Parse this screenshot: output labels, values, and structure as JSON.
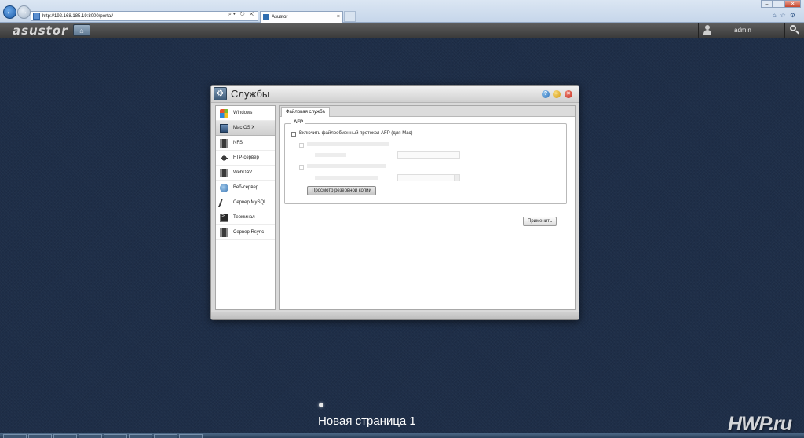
{
  "browser": {
    "address": "http://192.168.185.19:8000/portal/",
    "tab_title": "Asustor",
    "tab_close": "×",
    "window_controls": {
      "minimize": "–",
      "maximize": "□",
      "close": "✕"
    },
    "toolbar_icons": "⌂☆⚙",
    "address_tools": "⌕▾ ↻ ✕"
  },
  "asustor_bar": {
    "logo": "asustor",
    "username": "admin"
  },
  "window": {
    "title": "Службы",
    "help": "?",
    "minimize": "–",
    "close": "×",
    "sidebar": [
      {
        "label": "Windows",
        "icon": "windows-icon"
      },
      {
        "label": "Mac OS X",
        "icon": "mac-icon",
        "active": true
      },
      {
        "label": "NFS",
        "icon": "server-icon"
      },
      {
        "label": "FTP-сервер",
        "icon": "ftp-icon"
      },
      {
        "label": "WebDAV",
        "icon": "server-icon"
      },
      {
        "label": "Веб-сервер",
        "icon": "web-icon"
      },
      {
        "label": "Сервер MySQL",
        "icon": "mysql-icon"
      },
      {
        "label": "Терминал",
        "icon": "terminal-icon"
      },
      {
        "label": "Сервер Rsync",
        "icon": "server-icon"
      }
    ],
    "content": {
      "tab": "Файловая служба",
      "legend": "AFP",
      "enable_afp": "Включить файлообменный протокол AFP (для Mac)",
      "backup_button": "Просмотр резервной копии",
      "apply_button": "Применить"
    }
  },
  "desktop": {
    "page_label": "Новая страница 1",
    "watermark": "HWP.ru"
  }
}
